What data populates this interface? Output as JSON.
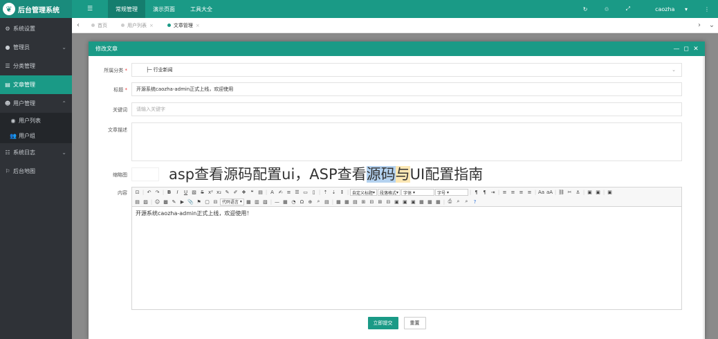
{
  "brand": {
    "title": "后台管理系统"
  },
  "sidebar": {
    "items": [
      {
        "label": "系统设置",
        "icon": "gears-icon"
      },
      {
        "label": "管理员",
        "icon": "user-icon"
      },
      {
        "label": "分类管理",
        "icon": "list-icon"
      },
      {
        "label": "文章管理",
        "icon": "article-icon"
      },
      {
        "label": "用户管理",
        "icon": "users-icon"
      },
      {
        "label": "用户列表",
        "icon": "user-circle-icon"
      },
      {
        "label": "用户组",
        "icon": "group-icon"
      },
      {
        "label": "系统日志",
        "icon": "log-icon"
      },
      {
        "label": "后台地图",
        "icon": "map-icon"
      }
    ]
  },
  "topbar": {
    "nav": [
      "常规管理",
      "演示页面",
      "工具大全"
    ],
    "user": "caozha"
  },
  "tabs": [
    "首页",
    "用户列表",
    "文章管理"
  ],
  "modal": {
    "title": "修改文章",
    "category_label": "所属分类",
    "category_value": "├─ 行业新闻",
    "title_label": "标题",
    "title_value": "开源系统caozha-admin正式上线，欢迎使用",
    "keywords_label": "关键词",
    "keywords_placeholder": "请输入关键字",
    "desc_label": "文章描述",
    "thumb_label": "缩略图",
    "content_label": "内容",
    "editor": {
      "code_lang": "代码语言",
      "custom_title": "自定义标题",
      "paragraph": "段落格式",
      "font": "字体",
      "font_size": "字号",
      "body": "开源系统caozha-admin正式上线，欢迎使用！"
    },
    "submit": "立即提交",
    "reset": "重置"
  },
  "watermark": {
    "part1": "asp查看源码配置ui，ASP查看",
    "part2": "源码",
    "part3": "与",
    "part4": "UI配置指南"
  }
}
